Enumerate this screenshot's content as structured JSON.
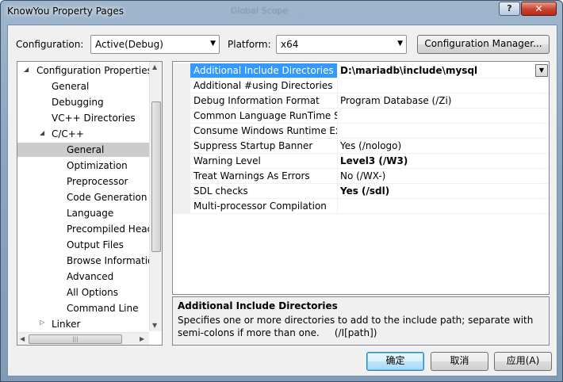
{
  "window": {
    "title": "KnowYou Property Pages",
    "blurred_title": "Global Scope"
  },
  "toolbar": {
    "configuration_label": "Configuration:",
    "configuration_value": "Active(Debug)",
    "platform_label": "Platform:",
    "platform_value": "x64",
    "config_manager_label": "Configuration Manager..."
  },
  "tree": {
    "items": [
      {
        "label": "Configuration Properties"
      },
      {
        "label": "General"
      },
      {
        "label": "Debugging"
      },
      {
        "label": "VC++ Directories"
      },
      {
        "label": "C/C++"
      },
      {
        "label": "General"
      },
      {
        "label": "Optimization"
      },
      {
        "label": "Preprocessor"
      },
      {
        "label": "Code Generation"
      },
      {
        "label": "Language"
      },
      {
        "label": "Precompiled Head"
      },
      {
        "label": "Output Files"
      },
      {
        "label": "Browse Informatio"
      },
      {
        "label": "Advanced"
      },
      {
        "label": "All Options"
      },
      {
        "label": "Command Line"
      },
      {
        "label": "Linker"
      }
    ]
  },
  "grid": {
    "rows": [
      {
        "name": "Additional Include Directories",
        "value": "D:\\mariadb\\include\\mysql"
      },
      {
        "name": "Additional #using Directories",
        "value": ""
      },
      {
        "name": "Debug Information Format",
        "value": "Program Database (/Zi)"
      },
      {
        "name": "Common Language RunTime Su",
        "value": ""
      },
      {
        "name": "Consume Windows Runtime Ext",
        "value": ""
      },
      {
        "name": "Suppress Startup Banner",
        "value": "Yes (/nologo)"
      },
      {
        "name": "Warning Level",
        "value": "Level3 (/W3)"
      },
      {
        "name": "Treat Warnings As Errors",
        "value": "No (/WX-)"
      },
      {
        "name": "SDL checks",
        "value": "Yes (/sdl)"
      },
      {
        "name": "Multi-processor Compilation",
        "value": ""
      }
    ]
  },
  "description": {
    "title": "Additional Include Directories",
    "text": "Specifies one or more directories to add to the include path; separate with semi-colons if more than one.     (/I[path])"
  },
  "buttons": {
    "ok": "确定",
    "cancel": "取消",
    "apply": "应用(A)"
  },
  "colors": {
    "selection": "#3399ff",
    "tree_selection": "#cccccc",
    "close_button": "#c8412b"
  }
}
